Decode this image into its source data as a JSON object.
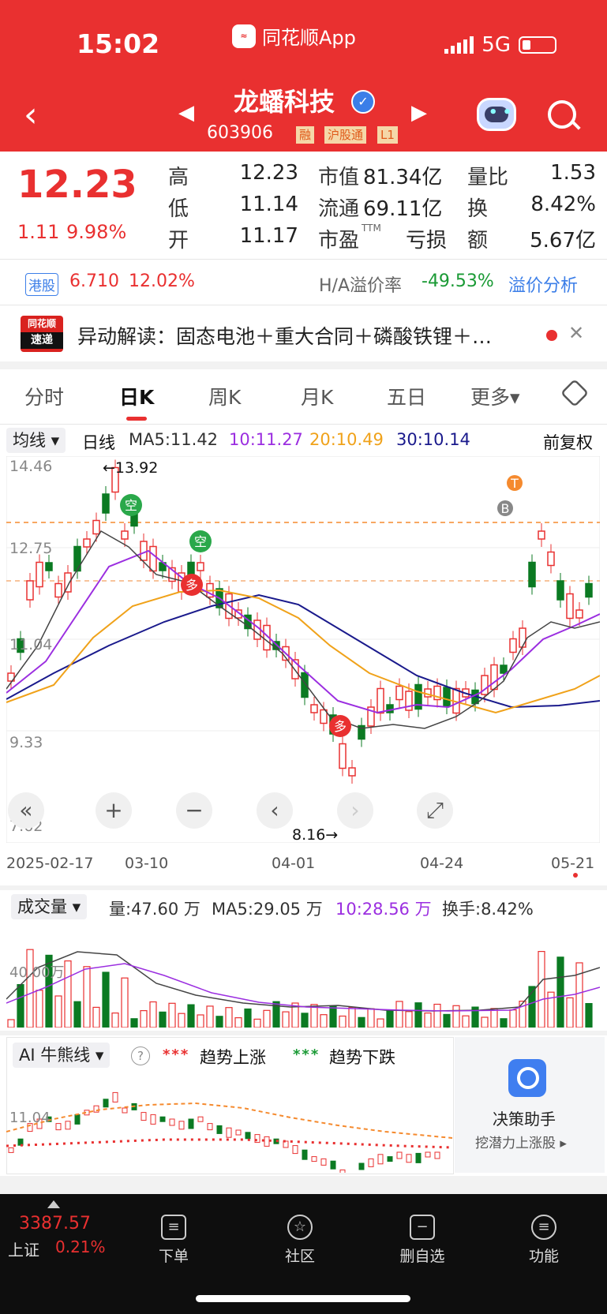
{
  "status_bar": {
    "time": "15:02",
    "app": "同花顺App",
    "network": "5G"
  },
  "header": {
    "back": "‹",
    "title": "龙蟠科技",
    "prev": "◀",
    "next": "▶",
    "code": "603906",
    "tags": [
      "融",
      "沪股通",
      "L1"
    ]
  },
  "quote": {
    "price": "12.23",
    "change": "1.11",
    "change_pct": "9.98%",
    "high_label": "高",
    "high": "12.23",
    "low_label": "低",
    "low": "11.14",
    "open_label": "开",
    "open": "11.17",
    "mcap_label": "市值",
    "mcap": "81.34亿",
    "float_label": "流通",
    "float": "69.11亿",
    "pe_label": "市盈",
    "pe_sup": "TTM",
    "pe": "亏损",
    "vr_label": "量比",
    "vr": "1.53",
    "turnover_label": "换",
    "turnover": "8.42%",
    "amount_label": "额",
    "amount": "5.67亿"
  },
  "hk": {
    "tag": "港股",
    "price": "6.710",
    "pct": "12.02%",
    "premium_label": "H/A溢价率",
    "premium": "-49.53%",
    "analysis": "溢价分析"
  },
  "news": {
    "logo_top": "同花顺",
    "logo_bottom": "速递",
    "text": "异动解读：固态电池＋重大合同＋磷酸铁锂＋…",
    "close": "✕"
  },
  "tabs": [
    "分时",
    "日K",
    "周K",
    "月K",
    "五日",
    "更多▾"
  ],
  "ma_bar": {
    "selector": "均线 ▾",
    "type": "日线",
    "ma5": "MA5:11.42",
    "ma10": "10:11.27",
    "ma20": "20:10.49",
    "ma30": "30:10.14",
    "adjust": "前复权"
  },
  "kline": {
    "y_labels": [
      "14.46",
      "12.75",
      "11.04",
      "9.33",
      "7.62"
    ],
    "high_mark": "←13.92",
    "low_mark": "8.16→",
    "dates": [
      "2025-02-17",
      "03-10",
      "04-01",
      "04-24",
      "05-21"
    ],
    "signals": [
      "空",
      "空",
      "多",
      "多",
      "B",
      "T"
    ],
    "controls": [
      "«",
      "+",
      "−",
      "‹",
      "›",
      "⤢"
    ]
  },
  "volume": {
    "selector": "成交量 ▾",
    "vol": "量:47.60 万",
    "ma5": "MA5:29.05 万",
    "ma10": "10:28.56 万",
    "turnover": "换手:8.42%",
    "y_label": "40.00万"
  },
  "ai": {
    "selector": "AI 牛熊线 ▾",
    "help": "?",
    "up_label": "趋势上涨",
    "down_label": "趋势下跌",
    "y_label": "11.04",
    "assistant": "决策助手",
    "assistant_sub": "挖潜力上涨股 ▸"
  },
  "bottom": {
    "index_value": "3387.57",
    "index_name": "上证",
    "index_pct": "0.21%",
    "items": [
      "下单",
      "社区",
      "删自选",
      "功能"
    ]
  }
}
